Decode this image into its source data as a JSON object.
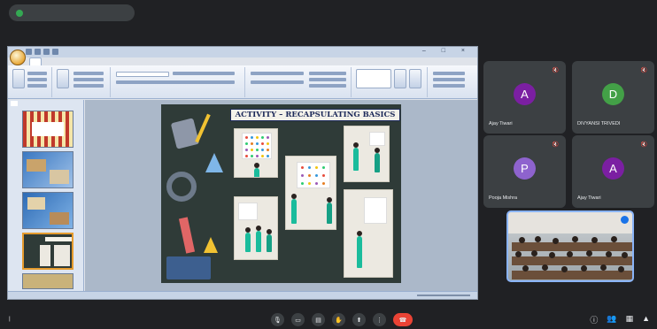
{
  "meet": {
    "presenting_banner": "",
    "time": "",
    "separator": "|",
    "meeting_code": ""
  },
  "ppt": {
    "doc_title": "",
    "window_controls": "– □ ×",
    "tabs": [
      "",
      "",
      "",
      "",
      "",
      "",
      ""
    ],
    "groups": [
      "",
      "",
      "",
      "",
      "",
      ""
    ],
    "pane_tabs": [
      "",
      ""
    ],
    "thumb_numbers": [
      "",
      "",
      "",
      "",
      ""
    ],
    "status_slide": "",
    "status_theme": "",
    "status_lang": ""
  },
  "slide": {
    "title": "ACTIVITY – RECAPSULATING BASICS"
  },
  "participants": [
    {
      "initial": "A",
      "name": "Ajay Tiwari",
      "color": "#7b1fa2"
    },
    {
      "initial": "D",
      "name": "DIVYANSI TRIVEDI",
      "color": "#43a047"
    },
    {
      "initial": "P",
      "name": "Pooja Mishra",
      "color": "#8e63ce"
    },
    {
      "initial": "A",
      "name": "Ajay Tiwari",
      "color": "#7b1fa2"
    }
  ],
  "icons": {
    "mic": "mic-icon",
    "camera": "camera-icon",
    "captions": "captions-icon",
    "hand": "raise-hand-icon",
    "present": "present-icon",
    "more": "more-options-icon",
    "end": "end-call-icon",
    "info": "info-icon",
    "people": "people-icon",
    "chat": "chat-icon",
    "activities": "activities-icon"
  }
}
